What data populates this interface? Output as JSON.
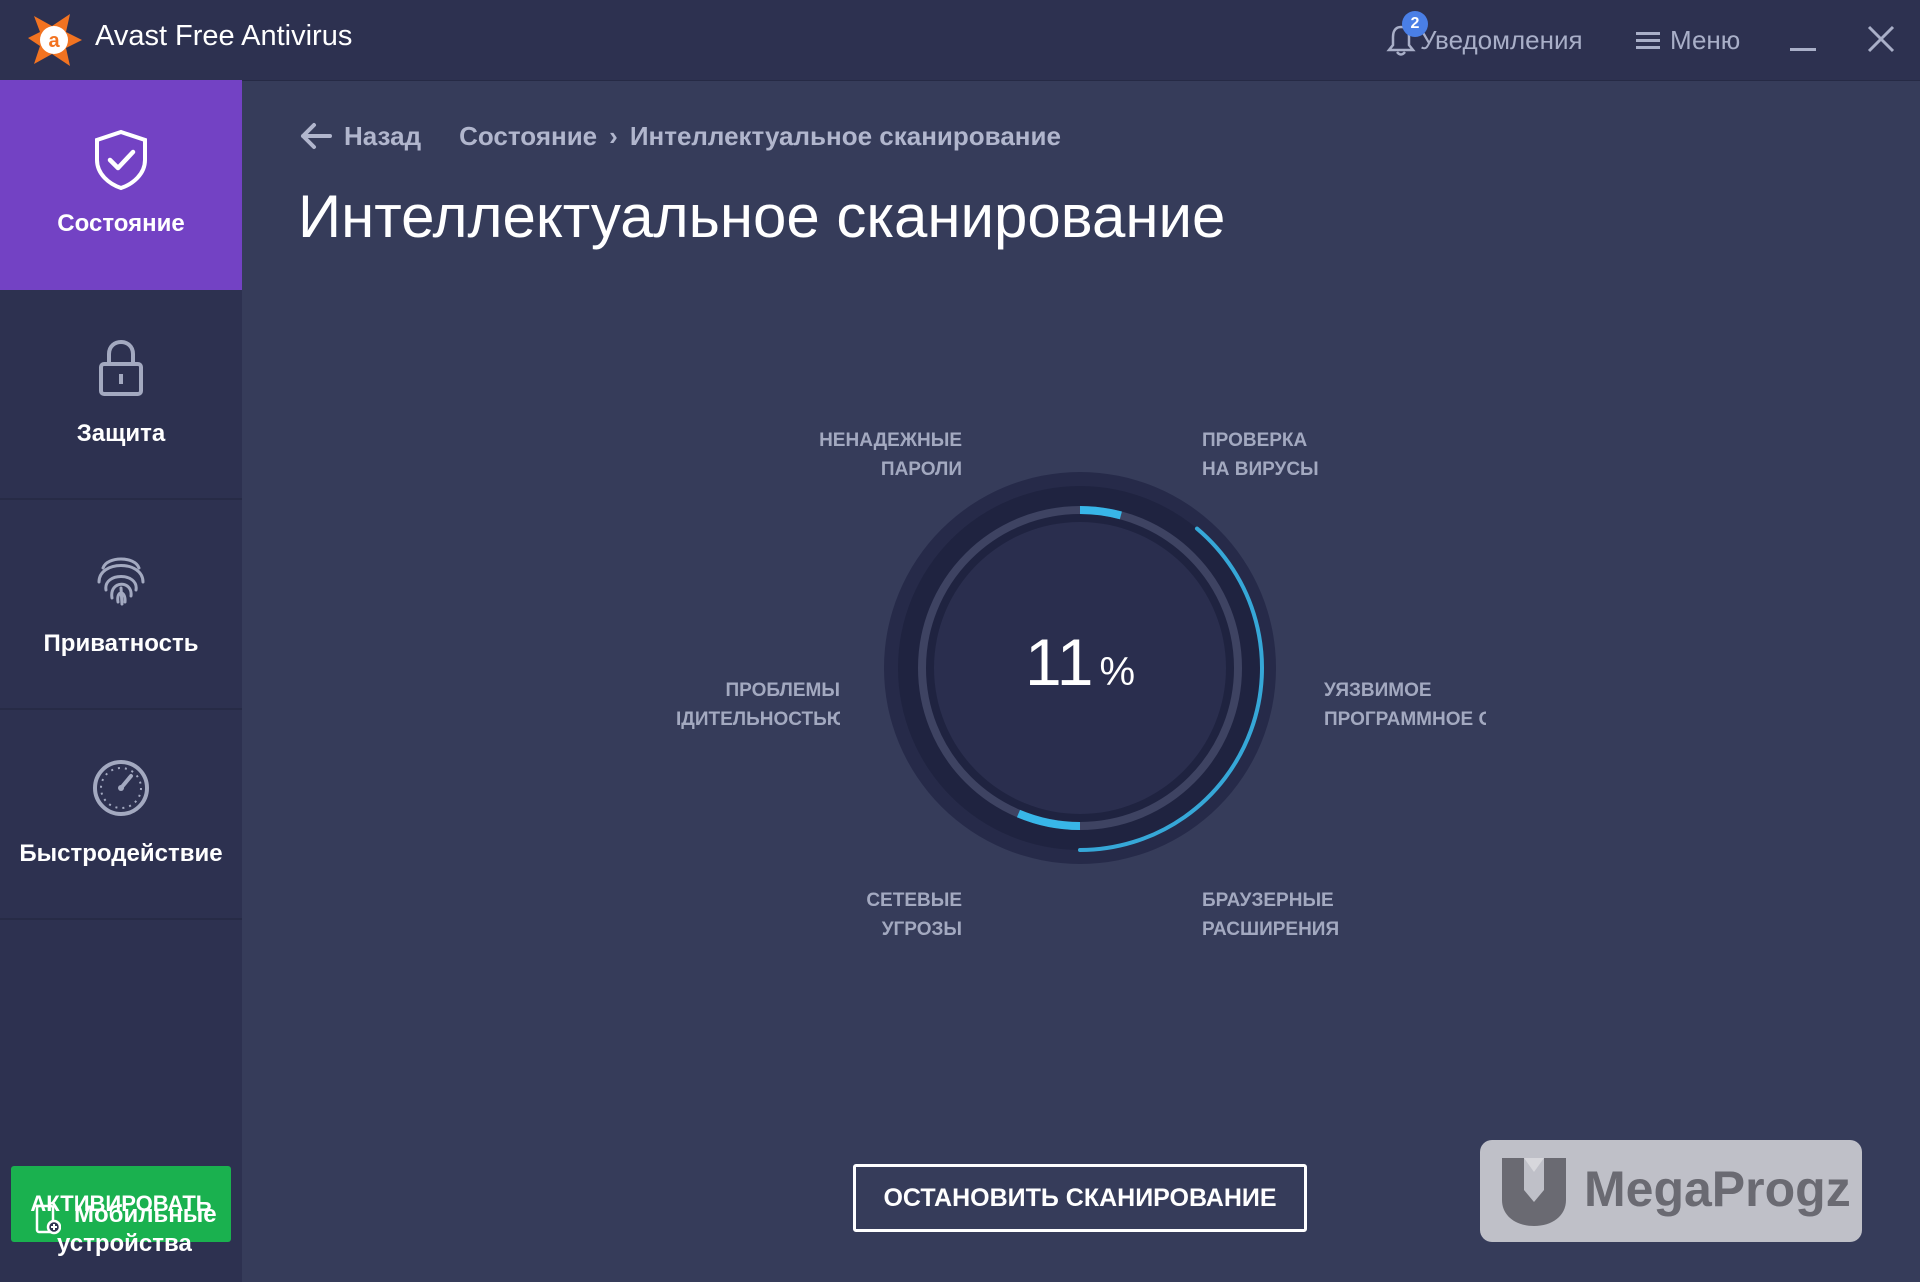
{
  "window": {
    "title": "Avast Free Antivirus",
    "notifications_label": "Уведомления",
    "notifications_count": "2",
    "menu_label": "Меню"
  },
  "sidebar": {
    "items": [
      {
        "label": "Состояние",
        "icon": "shield-check-icon",
        "active": true
      },
      {
        "label": "Защита",
        "icon": "lock-icon"
      },
      {
        "label": "Приватность",
        "icon": "fingerprint-icon"
      },
      {
        "label": "Быстродействие",
        "icon": "speedometer-icon"
      }
    ],
    "activate_label": "АКТИВИРОВАТЬ",
    "mobile_line1": "Мобильные",
    "mobile_line2": "устройства"
  },
  "breadcrumb": {
    "back_label": "Назад",
    "parent": "Состояние",
    "separator": "›",
    "current": "Интеллектуальное сканирование"
  },
  "page_title": "Интеллектуальное сканирование",
  "scan": {
    "progress_percent": "11",
    "percent_sign": "%",
    "categories": {
      "passwords": [
        "НЕНАДЕЖНЫЕ",
        "ПАРОЛИ"
      ],
      "viruses": [
        "ПРОВЕРКА",
        "НА ВИРУСЫ"
      ],
      "performance": [
        "ПРОБЛЕМЫ",
        "ІДИТЕЛЬНОСТЬЮ"
      ],
      "software": [
        "УЯЗВИМОЕ",
        "ПРОГРАММНОЕ О"
      ],
      "network": [
        "СЕТЕВЫЕ",
        "УГРОЗЫ"
      ],
      "browser": [
        "БРАУЗЕРНЫЕ",
        "РАСШИРЕНИЯ"
      ]
    },
    "stop_label": "ОСТАНОВИТЬ СКАНИРОВАНИЕ"
  },
  "watermark": {
    "text": "MegaProgz"
  },
  "colors": {
    "background": "#363c5a",
    "sidebar": "#2d3150",
    "active_nav": "#7342c4",
    "activate_button": "#1ab14f",
    "progress_accent": "#38b6e8",
    "brand_orange": "#f27321"
  }
}
